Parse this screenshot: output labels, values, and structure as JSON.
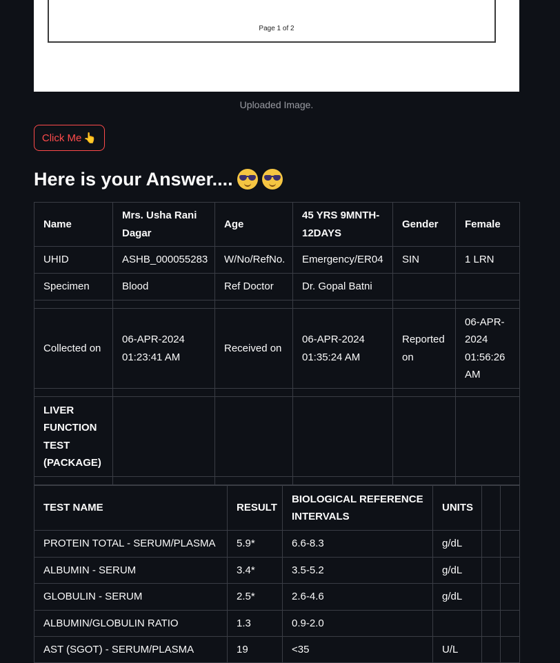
{
  "uploaded_image": {
    "page_label": "Page 1 of 2",
    "caption": "Uploaded Image."
  },
  "button": {
    "label": "Click Me",
    "icon": "pointing-hand-icon"
  },
  "answer_heading": "Here is your Answer....",
  "patient_table": {
    "rows": [
      [
        "Name",
        "Mrs. Usha Rani Dagar",
        "Age",
        "45 YRS 9MNTH-12DAYS",
        "Gender",
        "Female"
      ],
      [
        "UHID",
        "ASHB_000055283",
        "W/No/RefNo.",
        "Emergency/ER04",
        "SIN",
        "1 LRN"
      ],
      [
        "Specimen",
        "Blood",
        "Ref Doctor",
        "Dr. Gopal Batni",
        "",
        ""
      ],
      [
        "",
        "",
        "",
        "",
        "",
        ""
      ],
      [
        "Collected on",
        "06-APR-2024 01:23:41 AM",
        "Received on",
        "06-APR-2024 01:35:24 AM",
        "Reported on",
        "06-APR-2024 01:56:26 AM"
      ],
      [
        "",
        "",
        "",
        "",
        "",
        ""
      ],
      [
        "LIVER FUNCTION TEST (PACKAGE)",
        "",
        "",
        "",
        "",
        ""
      ],
      [
        "",
        "",
        "",
        "",
        "",
        ""
      ]
    ]
  },
  "results_table": {
    "headers": [
      "TEST NAME",
      "RESULT",
      "BIOLOGICAL REFERENCE INTERVALS",
      "UNITS",
      "",
      ""
    ],
    "rows": [
      [
        "PROTEIN TOTAL - SERUM/PLASMA",
        "5.9*",
        "6.6-8.3",
        "g/dL",
        "",
        ""
      ],
      [
        "ALBUMIN - SERUM",
        "3.4*",
        "3.5-5.2",
        "g/dL",
        "",
        ""
      ],
      [
        "GLOBULIN - SERUM",
        "2.5*",
        "2.6-4.6",
        "g/dL",
        "",
        ""
      ],
      [
        "ALBUMIN/GLOBULIN RATIO",
        "1.3",
        "0.9-2.0",
        "",
        "",
        ""
      ],
      [
        "AST (SGOT) - SERUM/PLASMA",
        "19",
        "<35",
        "U/L",
        "",
        ""
      ]
    ]
  },
  "colors": {
    "background": "#0e1117",
    "accent": "#ff4b4b",
    "border": "#3a3d45"
  }
}
